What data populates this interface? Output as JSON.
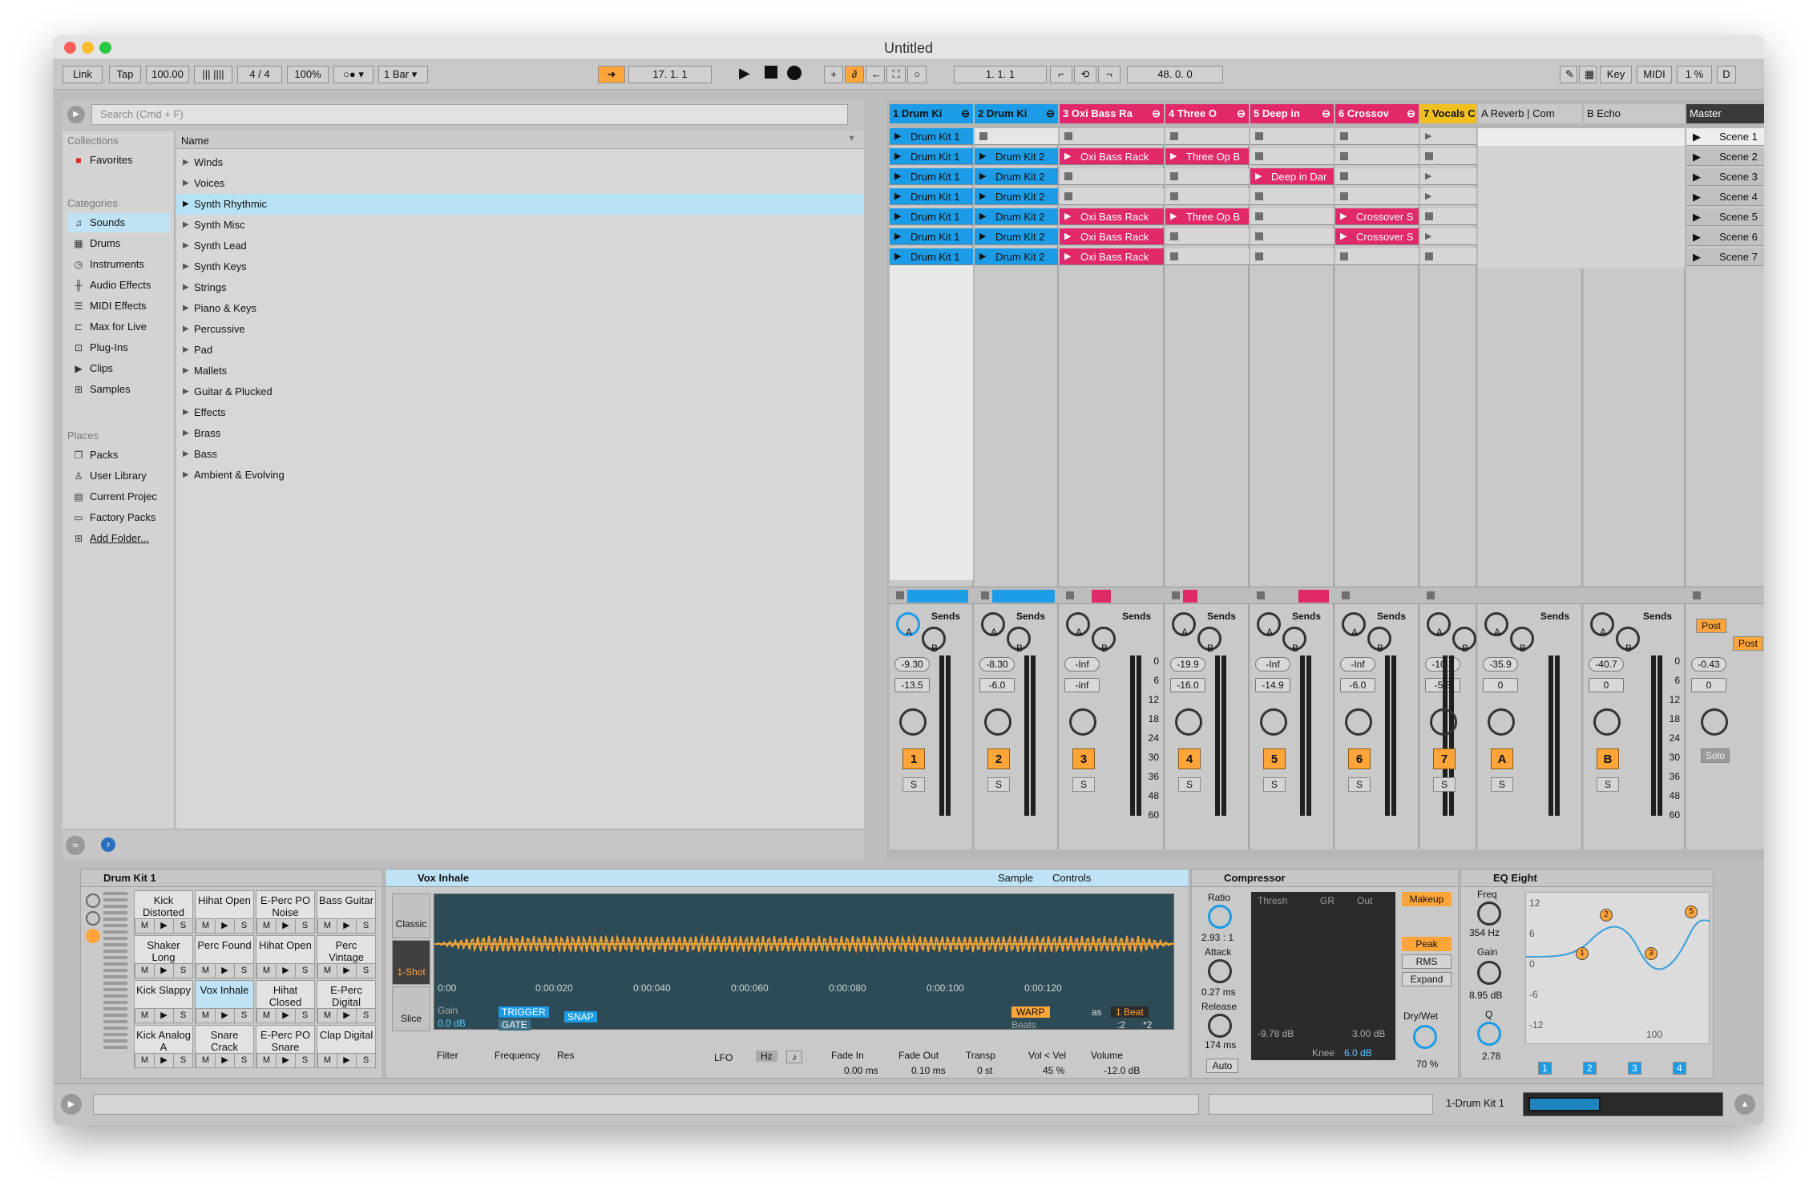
{
  "window": {
    "title": "Untitled"
  },
  "toolbar": {
    "link": "Link",
    "tap": "Tap",
    "tempo": "100.00",
    "signature": "4 / 4",
    "zoom": "100%",
    "quantize": "1 Bar",
    "position": "17.   1.   1",
    "loop_start": "1.   1.   1",
    "loop_length": "48.   0.   0",
    "key": "Key",
    "midi": "MIDI",
    "cpu": "1 %",
    "d": "D"
  },
  "browser": {
    "search_placeholder": "Search (Cmd + F)",
    "collections_header": "Collections",
    "favorites": "Favorites",
    "categories_header": "Categories",
    "categories": [
      "Sounds",
      "Drums",
      "Instruments",
      "Audio Effects",
      "MIDI Effects",
      "Max for Live",
      "Plug-Ins",
      "Clips",
      "Samples"
    ],
    "places_header": "Places",
    "places": [
      "Packs",
      "User Library",
      "Current Projec",
      "Factory Packs",
      "Add Folder..."
    ],
    "name_header": "Name",
    "names": [
      "Winds",
      "Voices",
      "Synth Rhythmic",
      "Synth Misc",
      "Synth Lead",
      "Synth Keys",
      "Strings",
      "Piano & Keys",
      "Percussive",
      "Pad",
      "Mallets",
      "Guitar & Plucked",
      "Effects",
      "Brass",
      "Bass",
      "Ambient & Evolving"
    ],
    "selected_name": "Synth Rhythmic"
  },
  "tracks": [
    {
      "name": "1 Drum Ki",
      "color": "#1c9be6",
      "num": "1",
      "vol": "-9.30",
      "pan": "-13.5"
    },
    {
      "name": "2 Drum Ki",
      "color": "#1c9be6",
      "num": "2",
      "vol": "-8.30",
      "pan": "-6.0"
    },
    {
      "name": "3 Oxi Bass Ra",
      "color": "#e0286b",
      "num": "3",
      "vol": "-Inf",
      "pan": "-inf"
    },
    {
      "name": "4 Three O",
      "color": "#e0286b",
      "num": "4",
      "vol": "-19.9",
      "pan": "-16.0"
    },
    {
      "name": "5 Deep in",
      "color": "#e0286b",
      "num": "5",
      "vol": "-Inf",
      "pan": "-14.9"
    },
    {
      "name": "6 Crossov",
      "color": "#e0286b",
      "num": "6",
      "vol": "-Inf",
      "pan": "-6.0"
    },
    {
      "name": "7 Vocals C",
      "color": "#f0c020",
      "num": "7",
      "vol": "-10.3",
      "pan": "-5.3"
    },
    {
      "name": "A Reverb | Com",
      "color": "#c8c8c8",
      "num": "A",
      "vol": "-35.9",
      "pan": "0"
    },
    {
      "name": "B Echo",
      "color": "#c8c8c8",
      "num": "B",
      "vol": "-40.7",
      "pan": "0"
    }
  ],
  "master": {
    "name": "Master",
    "vol": "-0.43",
    "pan": "0",
    "post": "Post",
    "solo": "Solo"
  },
  "scenes": [
    "Scene 1",
    "Scene 2",
    "Scene 3",
    "Scene 4",
    "Scene 5",
    "Scene 6",
    "Scene 7"
  ],
  "clips": {
    "drumkit1": "Drum Kit 1",
    "drumkit2": "Drum Kit 2",
    "oxi": "Oxi Bass Rack",
    "three": "Three Op B",
    "deep": "Deep in Dar",
    "crossover": "Crossover S"
  },
  "mixer": {
    "sends": "Sends",
    "send_a": "A",
    "send_b": "B",
    "s": "S",
    "scale": [
      "0",
      "6",
      "12",
      "18",
      "24",
      "30",
      "36",
      "48",
      "60"
    ]
  },
  "drum_rack": {
    "title": "Drum Kit 1",
    "pads": [
      [
        "Kick Analog A",
        "Snare Crack",
        "E-Perc PO Snare",
        "Clap Digital"
      ],
      [
        "Kick Slappy",
        "Vox Inhale",
        "Hihat Closed",
        "E-Perc Digital"
      ],
      [
        "Shaker Long",
        "Perc Found",
        "Hihat Open",
        "Perc Vintage"
      ],
      [
        "Kick Distorted",
        "Hihat Open",
        "E-Perc PO Noise",
        "Bass Guitar"
      ]
    ],
    "m": "M",
    "s": "S"
  },
  "simpler": {
    "title": "Vox Inhale",
    "tab_sample": "Sample",
    "tab_controls": "Controls",
    "classic": "Classic",
    "oneshot": "1-Shot",
    "slice": "Slice",
    "time_labels": [
      "0:00",
      "0:00:020",
      "0:00:040",
      "0:00:060",
      "0:00:080",
      "0:00:100",
      "0:00:120"
    ],
    "gain_label": "Gain",
    "gain_value": "0.0 dB",
    "trigger": "TRIGGER",
    "gate": "GATE",
    "snap": "SNAP",
    "warp": "WARP",
    "as": "as",
    "beat": "1 Beat",
    "beats": "Beats",
    "div2": ":2",
    "mul2": "*2",
    "filter": "Filter",
    "frequency": "Frequency",
    "res": "Res",
    "lfo": "LFO",
    "hz": "Hz",
    "note": "♪",
    "fade_in": "Fade In",
    "fade_in_val": "0.00 ms",
    "fade_out": "Fade Out",
    "fade_out_val": "0.10 ms",
    "transp": "Transp",
    "transp_val": "0 st",
    "vol_vel": "Vol < Vel",
    "vol_vel_val": "45 %",
    "volume": "Volume",
    "volume_val": "-12.0 dB"
  },
  "compressor": {
    "title": "Compressor",
    "ratio": "Ratio",
    "ratio_val": "2.93 : 1",
    "attack": "Attack",
    "attack_val": "0.27 ms",
    "release": "Release",
    "release_val": "174 ms",
    "auto": "Auto",
    "thresh": "Thresh",
    "gr": "GR",
    "out": "Out",
    "thresh_val": "-9.78 dB",
    "out_val": "3.00 dB",
    "knee": "Knee",
    "knee_val": "6.0 dB",
    "makeup": "Makeup",
    "peak": "Peak",
    "rms": "RMS",
    "expand": "Expand",
    "drywet": "Dry/Wet",
    "drywet_val": "70 %"
  },
  "eq": {
    "title": "EQ Eight",
    "freq": "Freq",
    "freq_val": "354 Hz",
    "gain": "Gain",
    "gain_val": "8.95 dB",
    "q": "Q",
    "q_val": "2.78",
    "ylabels": [
      "12",
      "6",
      "0",
      "-6",
      "-12"
    ],
    "xlabel": "100",
    "bands": [
      "1",
      "2",
      "3",
      "4"
    ],
    "points": [
      "1",
      "2",
      "3",
      "5"
    ]
  },
  "status": {
    "track": "1-Drum Kit 1"
  }
}
